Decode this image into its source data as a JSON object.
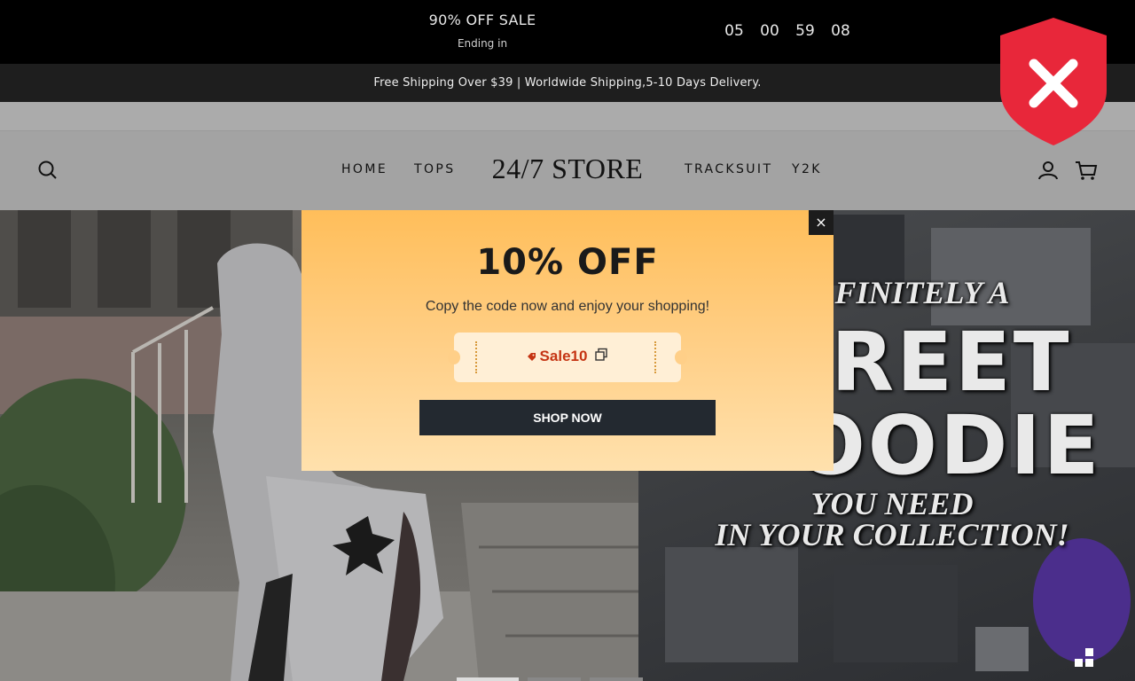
{
  "sale_bar": {
    "title": "90% OFF SALE",
    "subtitle": "Ending in",
    "countdown": [
      "05",
      "00",
      "59",
      "08"
    ]
  },
  "shipping_bar": {
    "text": "Free Shipping Over $39 | Worldwide Shipping,5-10 Days Delivery."
  },
  "header": {
    "logo": "24/7 STORE",
    "nav_left": [
      "HOME",
      "TOPS"
    ],
    "nav_right": [
      "TRACKSUIT",
      "Y2K"
    ],
    "icons": [
      "search-icon",
      "account-icon",
      "cart-icon"
    ]
  },
  "hero": {
    "lines": [
      "FINITELY A",
      "TREET",
      "OODIE",
      "YOU NEED",
      "IN YOUR COLLECTION!"
    ],
    "slide_count": 3,
    "active_slide": 1
  },
  "popup": {
    "title": "10% OFF",
    "subtitle": "Copy the code now and enjoy your shopping!",
    "code": "Sale10",
    "button": "SHOP NOW",
    "close": "×"
  },
  "colors": {
    "popup_top": "#ffbe5a",
    "popup_bottom": "#ffe1ad",
    "code_red": "#c53413",
    "shield_red": "#e8273a",
    "button_dark": "#232930"
  }
}
